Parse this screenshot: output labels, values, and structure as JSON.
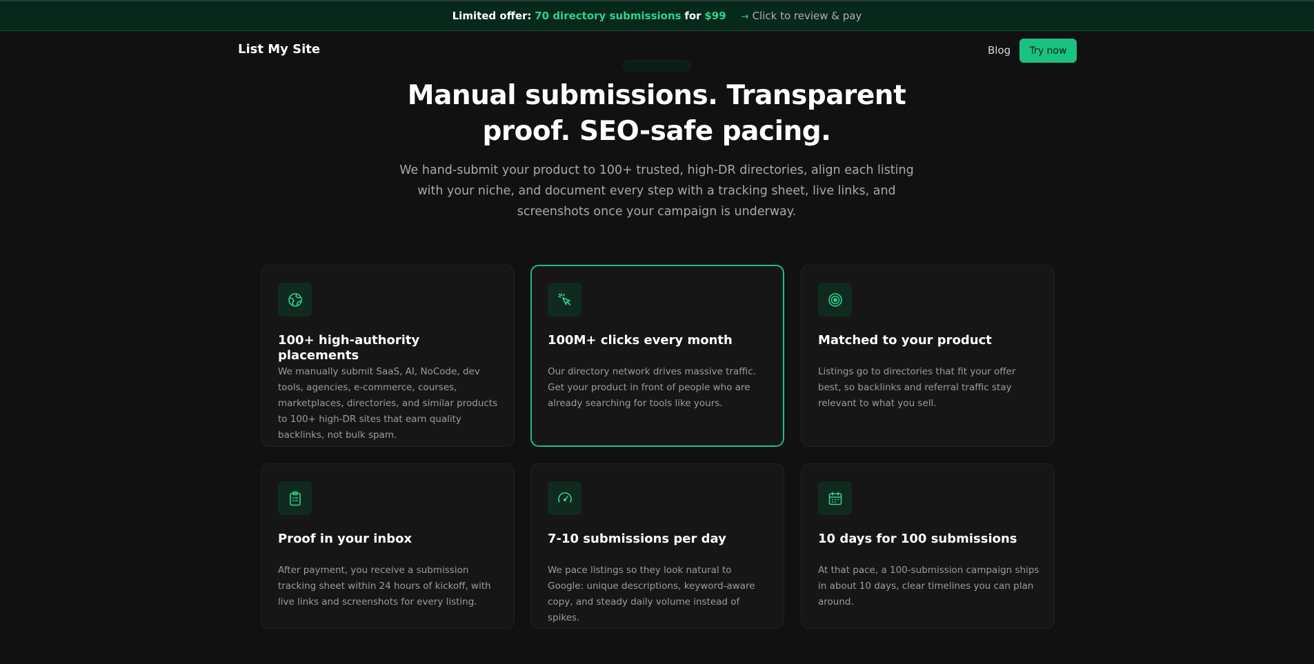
{
  "banner": {
    "prefix": "Limited offer:",
    "highlight": "70 directory submissions",
    "for_word": "for",
    "price": "$99",
    "arrow": "→",
    "cta": "Click to review & pay"
  },
  "nav": {
    "logo": "List My Site",
    "blog": "Blog",
    "try_now": "Try now"
  },
  "hero": {
    "title_line1": "Manual submissions. Transparent",
    "title_line2": "proof. SEO-safe pacing.",
    "subtitle": "We hand-submit your product to 100+ trusted, high-DR directories, align each listing with your niche, and document every step with a tracking sheet, live links, and screenshots once your campaign is underway."
  },
  "features": [
    {
      "icon": "globe-icon",
      "title": "100+ high-authority placements",
      "desc": "We manually submit SaaS, AI, NoCode, dev tools, agencies, e-commerce, courses, marketplaces, directories, and similar products to 100+ high-DR sites that earn quality backlinks, not bulk spam."
    },
    {
      "icon": "cursor-click-icon",
      "title": "100M+ clicks every month",
      "desc": "Our directory network drives massive traffic. Get your product in front of people who are already searching for tools like yours."
    },
    {
      "icon": "target-icon",
      "title": "Matched to your product",
      "desc": "Listings go to directories that fit your offer best, so backlinks and referral traffic stay relevant to what you sell."
    },
    {
      "icon": "clipboard-icon",
      "title": "Proof in your inbox",
      "desc": "After payment, you receive a submission tracking sheet within 24 hours of kickoff, with live links and screenshots for every listing."
    },
    {
      "icon": "gauge-icon",
      "title": "7-10 submissions per day",
      "desc": "We pace listings so they look natural to Google: unique descriptions, keyword-aware copy, and steady daily volume instead of spikes."
    },
    {
      "icon": "calendar-icon",
      "title": "10 days for 100 submissions",
      "desc": "At that pace, a 100-submission campaign ships in about 10 days, clear timelines you can plan around."
    }
  ],
  "colors": {
    "accent": "#19c281",
    "banner_bg": "#06291c",
    "page_bg": "#111111",
    "card_bg": "#161616"
  }
}
